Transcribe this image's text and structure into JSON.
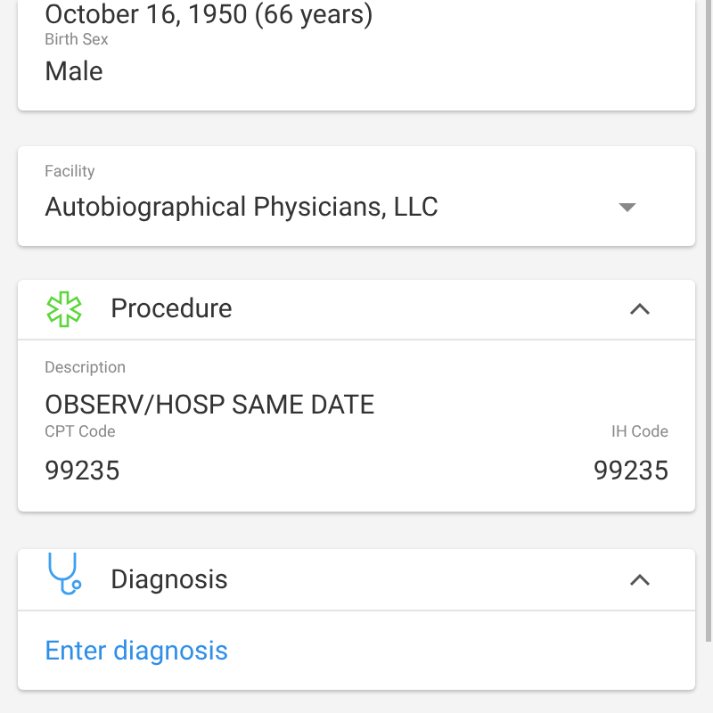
{
  "patient": {
    "birth_date": "October 16, 1950 (66 years)",
    "birth_sex_label": "Birth Sex",
    "birth_sex": "Male"
  },
  "facility": {
    "label": "Facility",
    "value": "Autobiographical Physicians, LLC"
  },
  "procedure": {
    "title": "Procedure",
    "expanded": true,
    "description_label": "Description",
    "description": "OBSERV/HOSP SAME DATE",
    "cpt_label": "CPT Code",
    "cpt": "99235",
    "ih_label": "IH Code",
    "ih": "99235"
  },
  "diagnosis": {
    "title": "Diagnosis",
    "expanded": true,
    "link": "Enter diagnosis"
  }
}
